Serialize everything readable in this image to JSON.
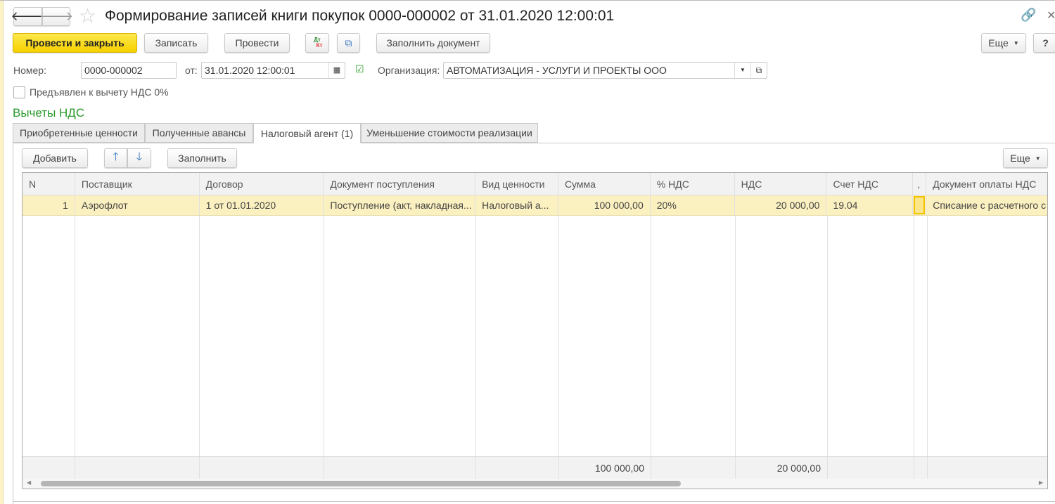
{
  "window": {
    "title": "Формирование записей книги покупок 0000-000002 от 31.01.2020 12:00:01"
  },
  "toolbar": {
    "post_close": "Провести и закрыть",
    "save": "Записать",
    "post": "Провести",
    "dtkt_dt": "Дт",
    "dtkt_kt": "Кт",
    "fill_doc": "Заполнить документ",
    "more": "Еще",
    "help": "?"
  },
  "header": {
    "number_label": "Номер:",
    "number": "0000-000002",
    "date_label": "от:",
    "date": "31.01.2020 12:00:01",
    "org_label": "Организация:",
    "org": "АВТОМАТИЗАЦИЯ - УСЛУГИ И ПРОЕКТЫ ООО",
    "checkbox_label": "Предъявлен к вычету НДС 0%",
    "checkbox_checked": false
  },
  "section_title": "Вычеты НДС",
  "tabs": [
    {
      "label": "Приобретенные ценности"
    },
    {
      "label": "Полученные авансы"
    },
    {
      "label": "Налоговый агент (1)",
      "active": true
    },
    {
      "label": "Уменьшение стоимости реализации"
    }
  ],
  "table_toolbar": {
    "add": "Добавить",
    "fill": "Заполнить",
    "more": "Еще"
  },
  "table": {
    "columns": [
      "N",
      "Поставщик",
      "Договор",
      "Документ поступления",
      "Вид ценности",
      "Сумма",
      "% НДС",
      "НДС",
      "Счет НДС",
      ",",
      "Документ оплаты НДС"
    ],
    "rows": [
      [
        "1",
        "Аэрофлот",
        "1 от 01.01.2020",
        "Поступление (акт, накладная...",
        "Налоговый а...",
        "100 000,00",
        "20%",
        "20 000,00",
        "19.04",
        "",
        "Списание с расчетного с"
      ]
    ],
    "totals": {
      "sum": "100 000,00",
      "vat": "20 000,00"
    }
  }
}
